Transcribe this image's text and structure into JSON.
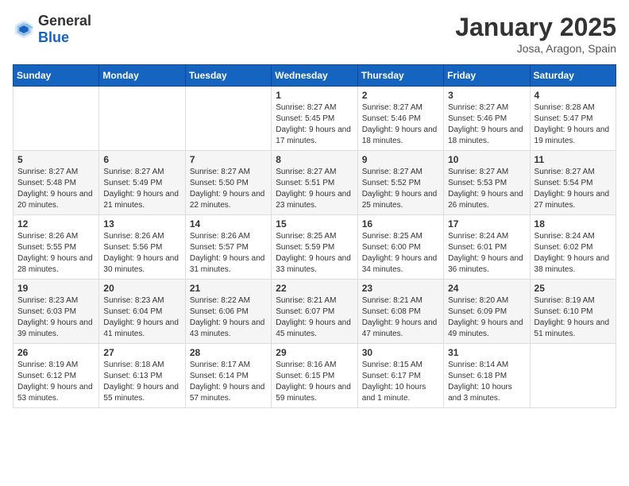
{
  "logo": {
    "general": "General",
    "blue": "Blue"
  },
  "header": {
    "title": "January 2025",
    "subtitle": "Josa, Aragon, Spain"
  },
  "weekdays": [
    "Sunday",
    "Monday",
    "Tuesday",
    "Wednesday",
    "Thursday",
    "Friday",
    "Saturday"
  ],
  "weeks": [
    [
      {
        "day": "",
        "info": ""
      },
      {
        "day": "",
        "info": ""
      },
      {
        "day": "",
        "info": ""
      },
      {
        "day": "1",
        "info": "Sunrise: 8:27 AM\nSunset: 5:45 PM\nDaylight: 9 hours and 17 minutes."
      },
      {
        "day": "2",
        "info": "Sunrise: 8:27 AM\nSunset: 5:46 PM\nDaylight: 9 hours and 18 minutes."
      },
      {
        "day": "3",
        "info": "Sunrise: 8:27 AM\nSunset: 5:46 PM\nDaylight: 9 hours and 18 minutes."
      },
      {
        "day": "4",
        "info": "Sunrise: 8:28 AM\nSunset: 5:47 PM\nDaylight: 9 hours and 19 minutes."
      }
    ],
    [
      {
        "day": "5",
        "info": "Sunrise: 8:27 AM\nSunset: 5:48 PM\nDaylight: 9 hours and 20 minutes."
      },
      {
        "day": "6",
        "info": "Sunrise: 8:27 AM\nSunset: 5:49 PM\nDaylight: 9 hours and 21 minutes."
      },
      {
        "day": "7",
        "info": "Sunrise: 8:27 AM\nSunset: 5:50 PM\nDaylight: 9 hours and 22 minutes."
      },
      {
        "day": "8",
        "info": "Sunrise: 8:27 AM\nSunset: 5:51 PM\nDaylight: 9 hours and 23 minutes."
      },
      {
        "day": "9",
        "info": "Sunrise: 8:27 AM\nSunset: 5:52 PM\nDaylight: 9 hours and 25 minutes."
      },
      {
        "day": "10",
        "info": "Sunrise: 8:27 AM\nSunset: 5:53 PM\nDaylight: 9 hours and 26 minutes."
      },
      {
        "day": "11",
        "info": "Sunrise: 8:27 AM\nSunset: 5:54 PM\nDaylight: 9 hours and 27 minutes."
      }
    ],
    [
      {
        "day": "12",
        "info": "Sunrise: 8:26 AM\nSunset: 5:55 PM\nDaylight: 9 hours and 28 minutes."
      },
      {
        "day": "13",
        "info": "Sunrise: 8:26 AM\nSunset: 5:56 PM\nDaylight: 9 hours and 30 minutes."
      },
      {
        "day": "14",
        "info": "Sunrise: 8:26 AM\nSunset: 5:57 PM\nDaylight: 9 hours and 31 minutes."
      },
      {
        "day": "15",
        "info": "Sunrise: 8:25 AM\nSunset: 5:59 PM\nDaylight: 9 hours and 33 minutes."
      },
      {
        "day": "16",
        "info": "Sunrise: 8:25 AM\nSunset: 6:00 PM\nDaylight: 9 hours and 34 minutes."
      },
      {
        "day": "17",
        "info": "Sunrise: 8:24 AM\nSunset: 6:01 PM\nDaylight: 9 hours and 36 minutes."
      },
      {
        "day": "18",
        "info": "Sunrise: 8:24 AM\nSunset: 6:02 PM\nDaylight: 9 hours and 38 minutes."
      }
    ],
    [
      {
        "day": "19",
        "info": "Sunrise: 8:23 AM\nSunset: 6:03 PM\nDaylight: 9 hours and 39 minutes."
      },
      {
        "day": "20",
        "info": "Sunrise: 8:23 AM\nSunset: 6:04 PM\nDaylight: 9 hours and 41 minutes."
      },
      {
        "day": "21",
        "info": "Sunrise: 8:22 AM\nSunset: 6:06 PM\nDaylight: 9 hours and 43 minutes."
      },
      {
        "day": "22",
        "info": "Sunrise: 8:21 AM\nSunset: 6:07 PM\nDaylight: 9 hours and 45 minutes."
      },
      {
        "day": "23",
        "info": "Sunrise: 8:21 AM\nSunset: 6:08 PM\nDaylight: 9 hours and 47 minutes."
      },
      {
        "day": "24",
        "info": "Sunrise: 8:20 AM\nSunset: 6:09 PM\nDaylight: 9 hours and 49 minutes."
      },
      {
        "day": "25",
        "info": "Sunrise: 8:19 AM\nSunset: 6:10 PM\nDaylight: 9 hours and 51 minutes."
      }
    ],
    [
      {
        "day": "26",
        "info": "Sunrise: 8:19 AM\nSunset: 6:12 PM\nDaylight: 9 hours and 53 minutes."
      },
      {
        "day": "27",
        "info": "Sunrise: 8:18 AM\nSunset: 6:13 PM\nDaylight: 9 hours and 55 minutes."
      },
      {
        "day": "28",
        "info": "Sunrise: 8:17 AM\nSunset: 6:14 PM\nDaylight: 9 hours and 57 minutes."
      },
      {
        "day": "29",
        "info": "Sunrise: 8:16 AM\nSunset: 6:15 PM\nDaylight: 9 hours and 59 minutes."
      },
      {
        "day": "30",
        "info": "Sunrise: 8:15 AM\nSunset: 6:17 PM\nDaylight: 10 hours and 1 minute."
      },
      {
        "day": "31",
        "info": "Sunrise: 8:14 AM\nSunset: 6:18 PM\nDaylight: 10 hours and 3 minutes."
      },
      {
        "day": "",
        "info": ""
      }
    ]
  ]
}
